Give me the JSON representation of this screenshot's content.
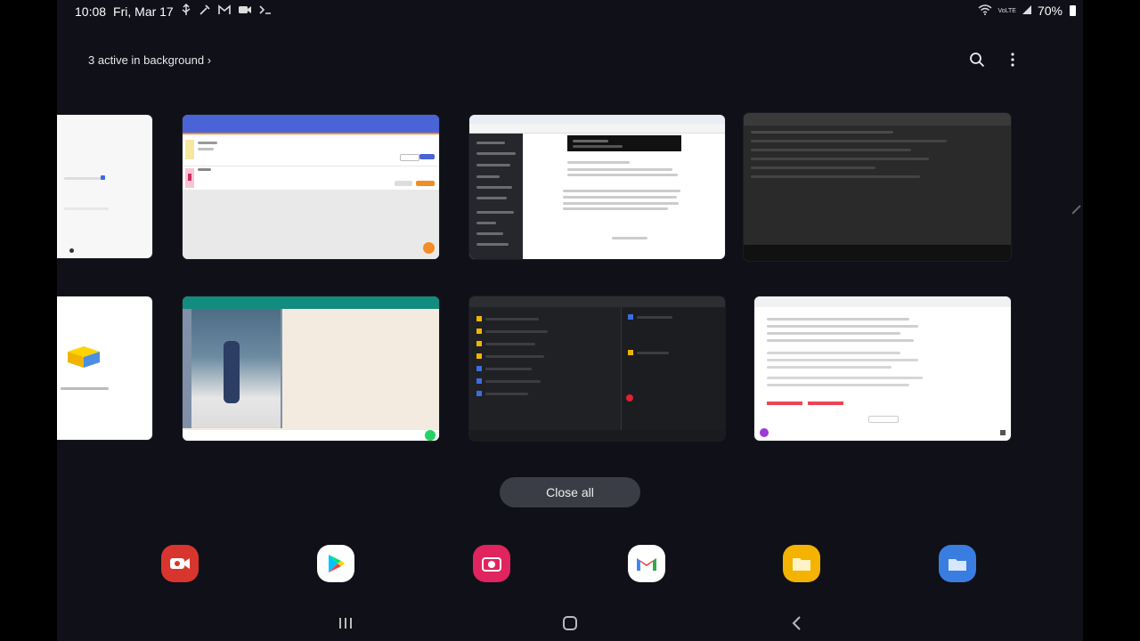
{
  "status_bar": {
    "time": "10:08",
    "date": "Fri, Mar 17",
    "battery": "70%",
    "network_label": "VoLTE"
  },
  "recents": {
    "active_in_background": "3 active in background",
    "chevron": "›",
    "close_all_label": "Close all",
    "cards": [
      {
        "app": "partial-left-top",
        "theme": "#f7f7f7"
      },
      {
        "app": "web-form",
        "theme": "#ffffff",
        "accent": "#4a63d6"
      },
      {
        "app": "browser-docs",
        "theme": "#ffffff",
        "accent": "#1c1d22"
      },
      {
        "app": "terminal",
        "theme": "#2a2a2a"
      },
      {
        "app": "partial-left-bottom",
        "theme": "#ffffff"
      },
      {
        "app": "whatsapp-chat",
        "theme": "#f3ebe0",
        "accent": "#128c7e"
      },
      {
        "app": "file-manager",
        "theme": "#202124"
      },
      {
        "app": "document-viewer",
        "theme": "#ffffff"
      }
    ]
  },
  "dock": {
    "apps": [
      {
        "name": "screen-recorder",
        "color": "#d8352f"
      },
      {
        "name": "play-store",
        "color": "#ffffff"
      },
      {
        "name": "camera",
        "color": "#e0245e"
      },
      {
        "name": "gmail",
        "color": "#ffffff"
      },
      {
        "name": "files",
        "color": "#f3b300"
      },
      {
        "name": "my-files",
        "color": "#3a7de0"
      }
    ]
  },
  "colors": {
    "background": "#0f1018",
    "close_all_bg": "#3a3d46"
  }
}
